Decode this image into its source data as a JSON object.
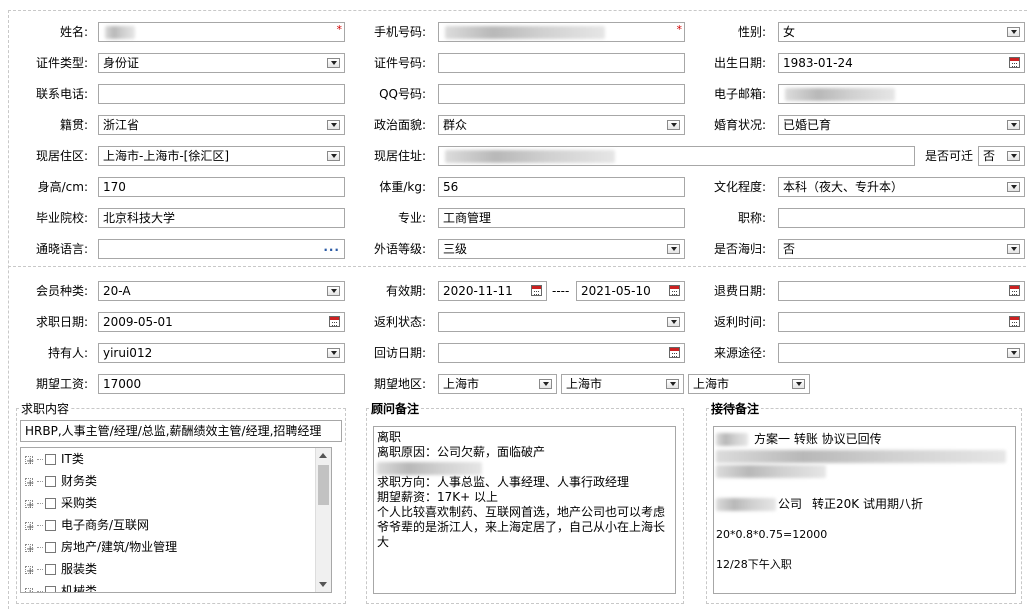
{
  "basic": {
    "name": {
      "label": "姓名:",
      "required": "*"
    },
    "phone": {
      "label": "手机号码:",
      "required": "*"
    },
    "gender": {
      "label": "性别:",
      "value": "女"
    },
    "id_type": {
      "label": "证件类型:",
      "value": "身份证"
    },
    "id_no": {
      "label": "证件号码:",
      "value": ""
    },
    "birthday": {
      "label": "出生日期:",
      "value": "1983-01-24"
    },
    "contact": {
      "label": "联系电话:",
      "value": ""
    },
    "qq": {
      "label": "QQ号码:",
      "value": ""
    },
    "email": {
      "label": "电子邮箱:"
    },
    "native": {
      "label": "籍贯:",
      "value": "浙江省"
    },
    "political": {
      "label": "政治面貌:",
      "value": "群众"
    },
    "marital": {
      "label": "婚育状况:",
      "value": "已婚已育"
    },
    "residence": {
      "label": "现居住区:",
      "value": "上海市-上海市-[徐汇区]"
    },
    "address": {
      "label": "现居住址:"
    },
    "relocate": {
      "label": "是否可迁",
      "value": "否"
    },
    "height": {
      "label": "身高/cm:",
      "value": "170"
    },
    "weight": {
      "label": "体重/kg:",
      "value": "56"
    },
    "education": {
      "label": "文化程度:",
      "value": "本科（夜大、专升本）"
    },
    "school": {
      "label": "毕业院校:",
      "value": "北京科技大学"
    },
    "major": {
      "label": "专业:",
      "value": "工商管理"
    },
    "title": {
      "label": "职称:",
      "value": ""
    },
    "language": {
      "label": "通晓语言:",
      "value": ""
    },
    "lang_level": {
      "label": "外语等级:",
      "value": "三级"
    },
    "overseas": {
      "label": "是否海归:",
      "value": "否"
    }
  },
  "member": {
    "type": {
      "label": "会员种类:",
      "value": "20-A"
    },
    "valid": {
      "label": "有效期:",
      "from": "2020-11-11",
      "sep": "----",
      "to": "2021-05-10"
    },
    "refund_date": {
      "label": "退费日期:",
      "value": ""
    },
    "job_date": {
      "label": "求职日期:",
      "value": "2009-05-01"
    },
    "rebate_status": {
      "label": "返利状态:",
      "value": ""
    },
    "rebate_time": {
      "label": "返利时间:",
      "value": ""
    },
    "holder": {
      "label": "持有人:",
      "value": "yirui012"
    },
    "visit_date": {
      "label": "回访日期:",
      "value": ""
    },
    "source": {
      "label": "来源途径:",
      "value": ""
    },
    "salary": {
      "label": "期望工资:",
      "value": "17000"
    },
    "area": {
      "label": "期望地区:",
      "province": "上海市",
      "city": "上海市",
      "district": "上海市"
    }
  },
  "job": {
    "title": "求职内容",
    "summary": "HRBP,人事主管/经理/总监,薪酬绩效主管/经理,招聘经理",
    "tree": [
      "IT类",
      "财务类",
      "采购类",
      "电子商务/互联网",
      "房地产/建筑/物业管理",
      "服装类",
      "机械类"
    ]
  },
  "advisor": {
    "title": "顾问备注",
    "lines": [
      "离职",
      "离职原因：公司欠薪，面临破产",
      "",
      "求职方向：人事总监、人事经理、人事行政经理",
      "期望薪资：17K+ 以上",
      "个人比较喜欢制药、互联网首选，地产公司也可以考虑",
      "爷爷辈的是浙江人，来上海定居了，自己从小在上海长",
      "大"
    ]
  },
  "reception": {
    "title": "接待备注",
    "line1": "方案一 转账 协议已回传",
    "line2a": "公司",
    "line2b": "转正20K 试用期八折",
    "line3": "20*0.8*0.75=12000",
    "line4": "12/28下午入职"
  }
}
